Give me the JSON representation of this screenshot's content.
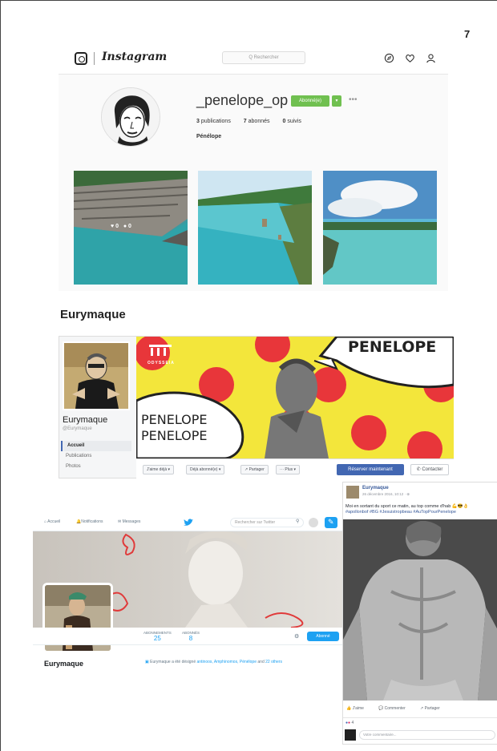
{
  "page_number": "7",
  "instagram": {
    "logo": "Instagram",
    "search_placeholder": "Q Rechercher",
    "username": "_penelope_op",
    "follow_button": "Abonné(e)",
    "more": "•••",
    "stats": {
      "posts_count": "3",
      "posts_label": "publications",
      "followers_count": "7",
      "followers_label": "abonnés",
      "following_count": "0",
      "following_label": "suivis"
    },
    "display_name": "Pénélope",
    "photo_overlay": {
      "likes": "0",
      "comments": "0"
    }
  },
  "facebook": {
    "section_title": "Eurymaque",
    "page_name": "Eurymaque",
    "handle": "@Eurymaque",
    "nav": [
      "Accueil",
      "Publications",
      "Photos"
    ],
    "cover_brand": "ODYSSEIA",
    "cover_text_top": "PENELOPE",
    "cover_text_line1": "PENELOPE",
    "cover_text_line2": "PENELOPE",
    "actions": [
      "J'aime déjà ▾",
      "Déjà abonné(e) ▾",
      "↗ Partager",
      "··· Plus ▾"
    ],
    "primary_button": "Réserver maintenant",
    "contact_button": "Contacter"
  },
  "twitter": {
    "nav": [
      "Accueil",
      "Notifications",
      "Messages"
    ],
    "search_placeholder": "Rechercher sur Twitter",
    "stats": [
      {
        "label": "ABONNEMENTS",
        "value": "25"
      },
      {
        "label": "ABONNÉS",
        "value": "8"
      }
    ],
    "follow_button": "Abonné",
    "name": "Eurymaque",
    "bio_prefix": "Eurymaque a été désigné",
    "bio_links": "antinoos, Amphinomos, Pénélope",
    "bio_suffix": "and",
    "bio_more": "22 others"
  },
  "post": {
    "author": "Eurymaque",
    "date": "26 décembre 2016, 10:12 · ⊕",
    "text": "Moi en sortant du sport ce matin, au top comme d'hab 💪😎👌",
    "tags": "#apollonbof #BG #Jesuistropbeau #AuTopPourPenelope",
    "actions": [
      "👍 J'aime",
      "💬 Commenter",
      "↗ Partager"
    ],
    "reactions": "4",
    "comment_placeholder": "Votre commentaire..."
  }
}
